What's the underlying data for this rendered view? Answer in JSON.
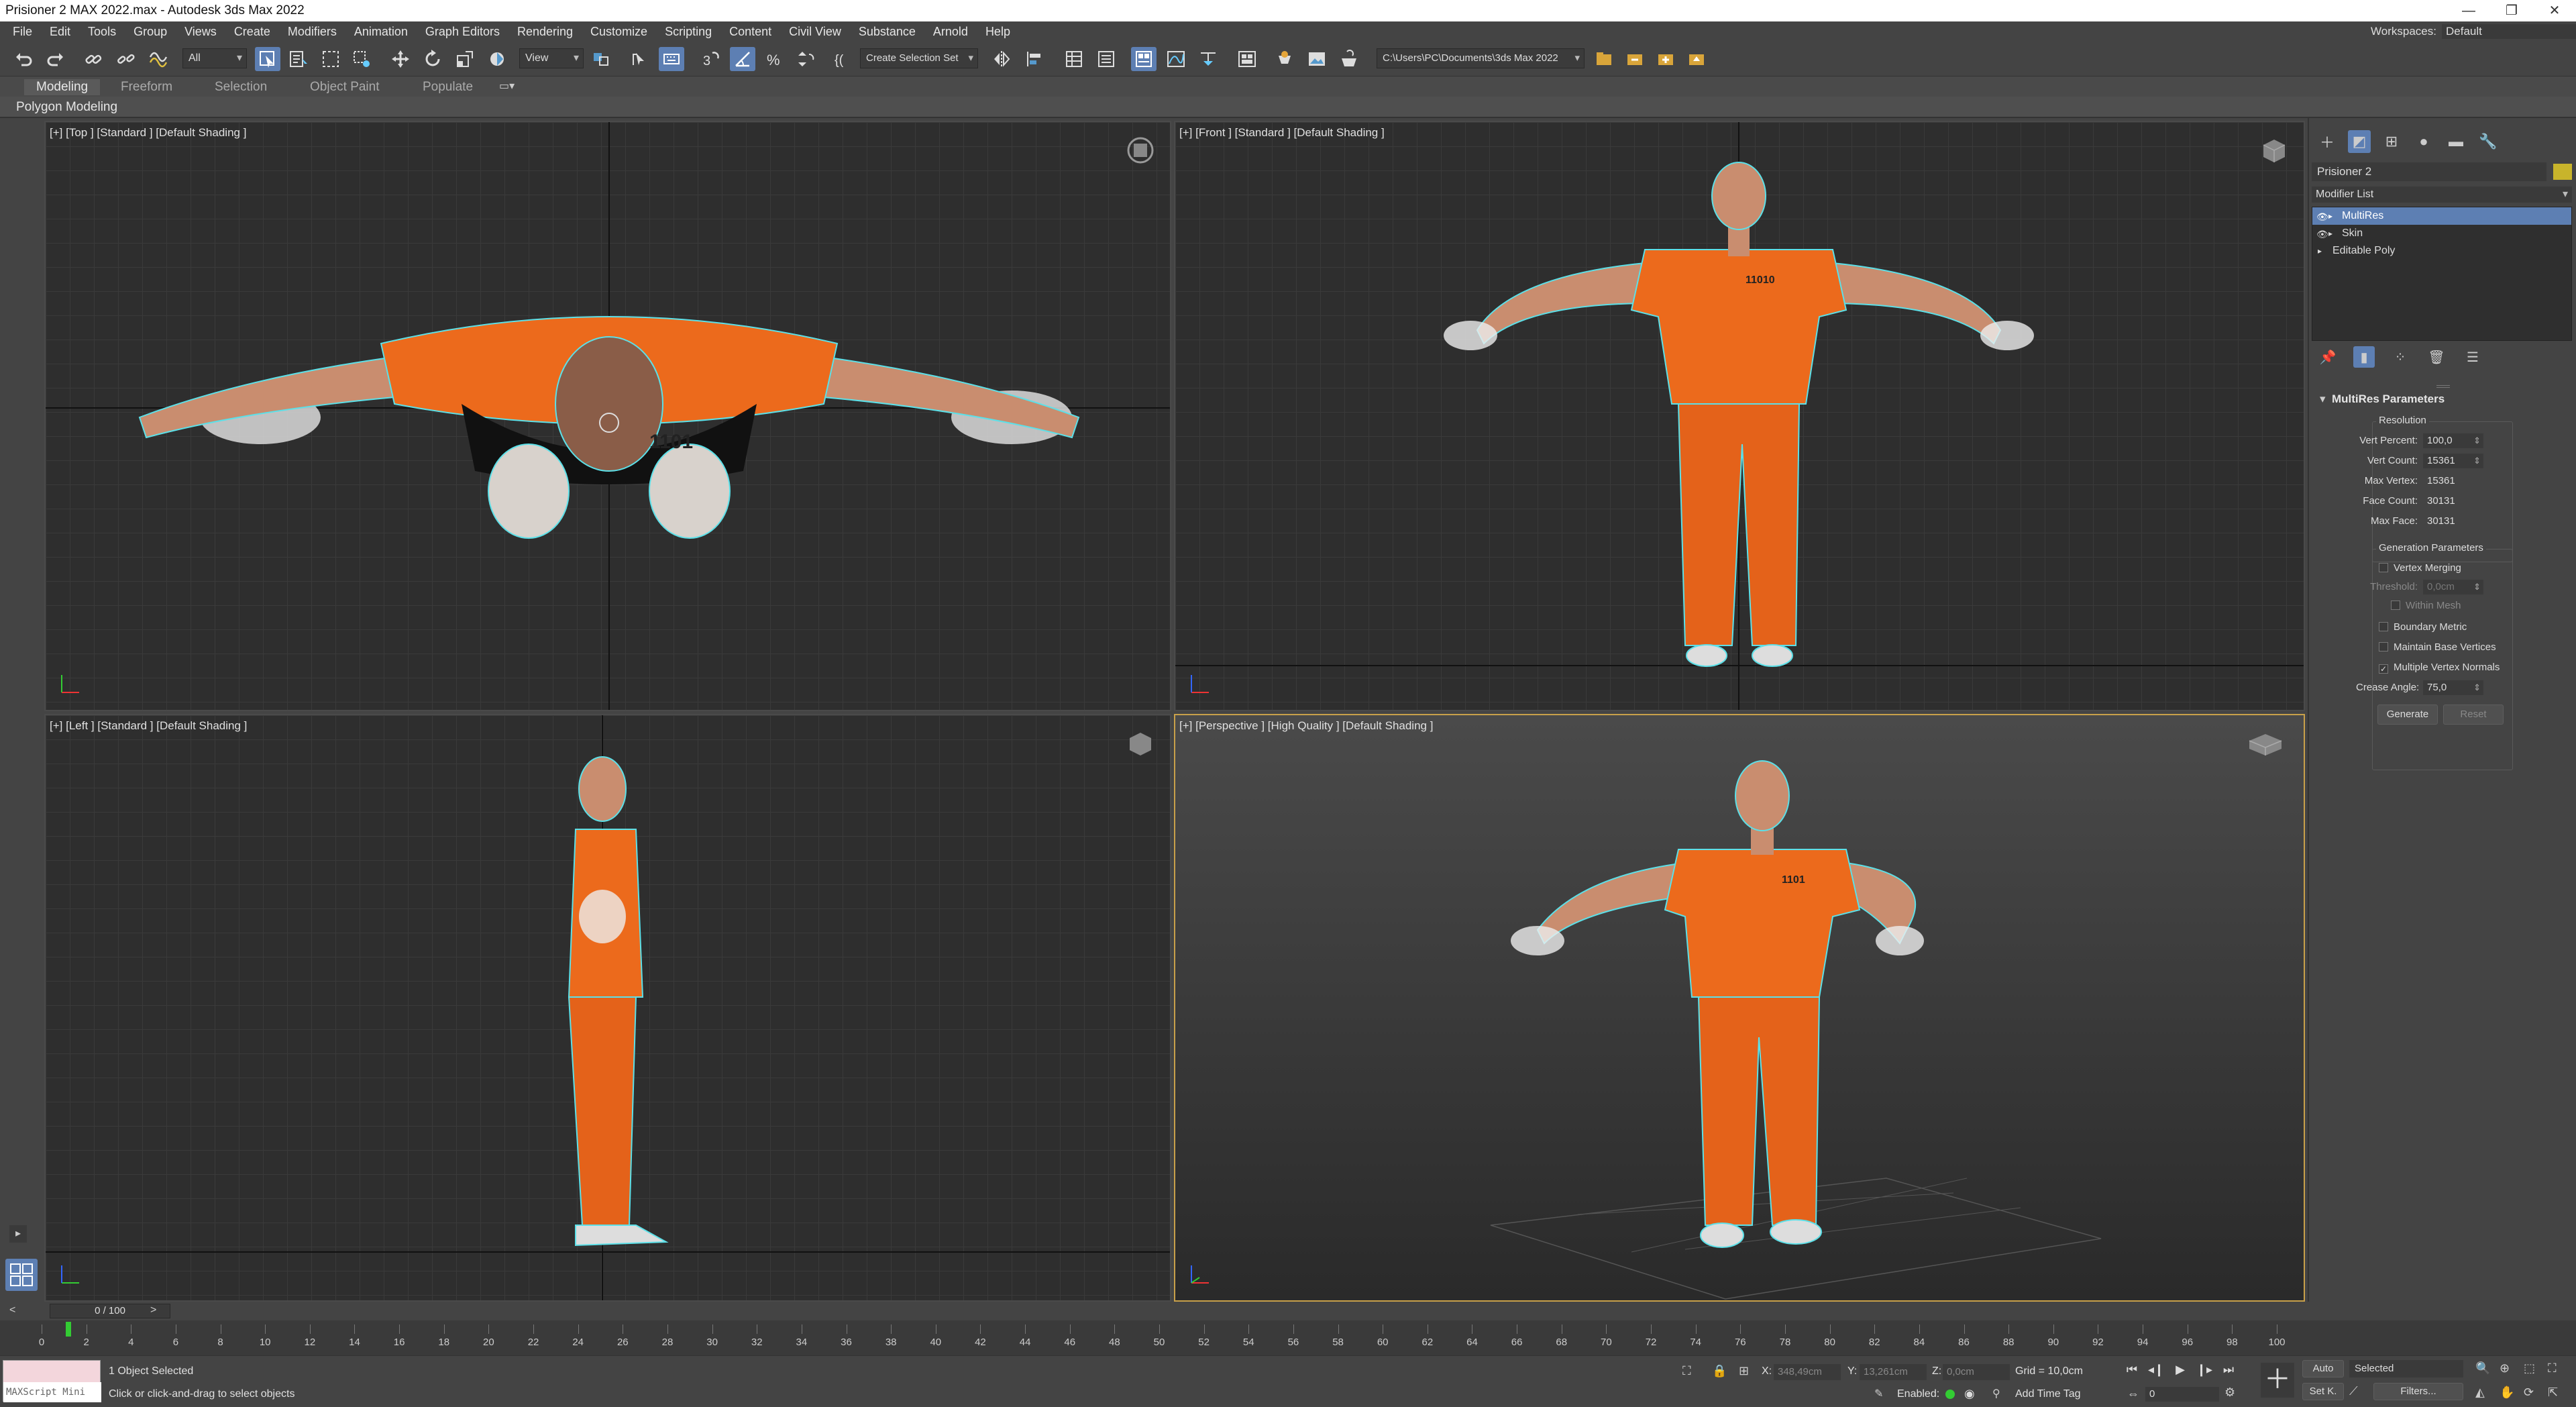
{
  "window": {
    "title": "Prisioner 2 MAX 2022.max - Autodesk 3ds Max 2022",
    "minimize": "—",
    "restore": "❐",
    "close": "✕"
  },
  "menu": {
    "items": [
      "File",
      "Edit",
      "Tools",
      "Group",
      "Views",
      "Create",
      "Modifiers",
      "Animation",
      "Graph Editors",
      "Rendering",
      "Customize",
      "Scripting",
      "Content",
      "Civil View",
      "Substance",
      "Arnold",
      "Help"
    ],
    "workspaces_label": "Workspaces:",
    "workspaces_value": "Default"
  },
  "toolbar": {
    "filter": "All",
    "refcoord": "View",
    "selection_set": "Create Selection Set",
    "project_path": "C:\\Users\\PC\\Documents\\3ds Max 2022"
  },
  "ribbon": {
    "tabs": [
      "Modeling",
      "Freeform",
      "Selection",
      "Object Paint",
      "Populate"
    ],
    "panel": "Polygon Modeling"
  },
  "viewports": {
    "top": "[+] [Top ] [Standard ] [Default Shading ]",
    "front": "[+] [Front ] [Standard ] [Default Shading ]",
    "left": "[+] [Left ] [Standard ] [Default Shading ]",
    "perspective": "[+] [Perspective ] [High Quality ] [Default Shading ]",
    "shirt_number": "11010",
    "shirt_number_partial": "1101"
  },
  "command_panel": {
    "object_name": "Prisioner 2",
    "modifier_list": "Modifier List",
    "stack": [
      "MultiRes",
      "Skin",
      "Editable Poly"
    ],
    "rollout_title": "MultiRes Parameters",
    "resolution": {
      "title": "Resolution",
      "vert_percent_label": "Vert Percent:",
      "vert_percent": "100,0",
      "vert_count_label": "Vert Count:",
      "vert_count": "15361",
      "max_vertex_label": "Max Vertex:",
      "max_vertex": "15361",
      "face_count_label": "Face Count:",
      "face_count": "30131",
      "max_face_label": "Max Face:",
      "max_face": "30131"
    },
    "generation": {
      "title": "Generation Parameters",
      "vertex_merging": "Vertex Merging",
      "threshold_label": "Threshold:",
      "threshold": "0,0cm",
      "within_mesh": "Within Mesh",
      "boundary_metric": "Boundary Metric",
      "maintain_base": "Maintain Base Vertices",
      "multiple_normals": "Multiple Vertex Normals",
      "crease_label": "Crease Angle:",
      "crease": "75,0",
      "generate": "Generate",
      "reset": "Reset"
    }
  },
  "timeline": {
    "slider": "0 / 100",
    "ticks": [
      "0",
      "2",
      "4",
      "6",
      "8",
      "10",
      "12",
      "14",
      "16",
      "18",
      "20",
      "22",
      "24",
      "26",
      "28",
      "30",
      "32",
      "34",
      "36",
      "38",
      "40",
      "42",
      "44",
      "46",
      "48",
      "50",
      "52",
      "54",
      "56",
      "58",
      "60",
      "62",
      "64",
      "66",
      "68",
      "70",
      "72",
      "74",
      "76",
      "78",
      "80",
      "82",
      "84",
      "86",
      "88",
      "90",
      "92",
      "94",
      "96",
      "98",
      "100"
    ]
  },
  "status": {
    "maxscript": "MAXScript Mini",
    "selected": "1 Object Selected",
    "prompt": "Click or click-and-drag to select objects",
    "x_label": "X:",
    "x": "348,49cm",
    "y_label": "Y:",
    "y": "13,261cm",
    "z_label": "Z:",
    "z": "0,0cm",
    "grid": "Grid = 10,0cm",
    "enabled": "Enabled:",
    "add_time_tag": "Add Time Tag",
    "auto": "Auto",
    "selected_dd": "Selected",
    "set_key": "Set K.",
    "filters": "Filters...",
    "frame": "0"
  }
}
